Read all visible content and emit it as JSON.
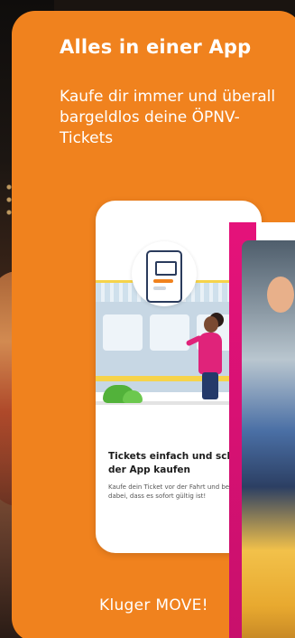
{
  "headline": "Alles in einer App",
  "subline": "Kaufe dir immer und überall bargeldlos deine ÖPNV-Tickets",
  "phone_card": {
    "title": "Tickets einfach und schnel\nder App kaufen",
    "text": "Kaufe dein Ticket vor der Fahrt und be\ndabei, dass es sofort gültig ist!"
  },
  "footer": "Kluger MOVE!",
  "colors": {
    "accent_orange": "#f0821e",
    "magenta": "#e5127a"
  }
}
